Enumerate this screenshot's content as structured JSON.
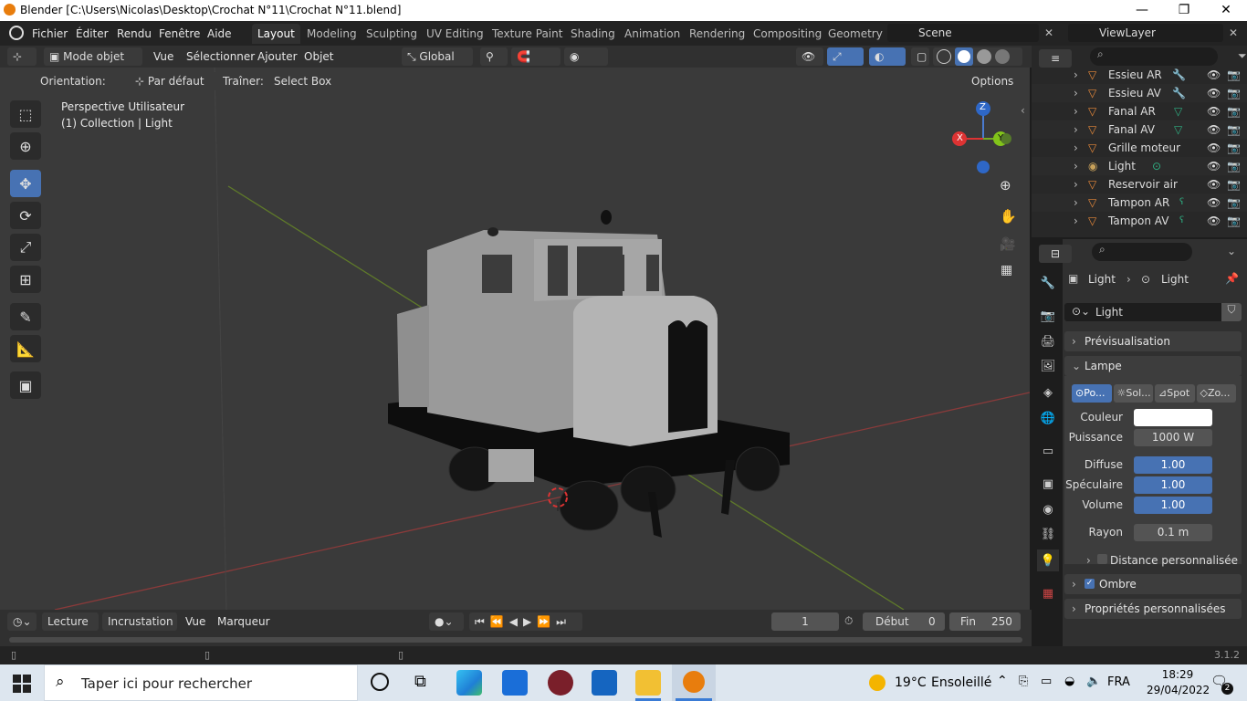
{
  "window": {
    "title": "Blender [C:\\Users\\Nicolas\\Desktop\\Crochat N°11\\Crochat N°11.blend]"
  },
  "menu": [
    "Fichier",
    "Éditer",
    "Rendu",
    "Fenêtre",
    "Aide"
  ],
  "workspaces": [
    "Layout",
    "Modeling",
    "Sculpting",
    "UV Editing",
    "Texture Paint",
    "Shading",
    "Animation",
    "Rendering",
    "Compositing",
    "Geometry"
  ],
  "scene": "Scene",
  "view_layer": "ViewLayer",
  "header": {
    "mode": "Mode objet",
    "menus": [
      "Vue",
      "Sélectionner",
      "Ajouter",
      "Objet"
    ],
    "transform": "Global",
    "orientation_label": "Orientation:",
    "orientation_value": "Par défaut",
    "drag_label": "Traîner:",
    "drag_value": "Select Box",
    "options": "Options"
  },
  "viewport": {
    "line1": "Perspective Utilisateur",
    "line2": "(1) Collection | Light"
  },
  "gizmo": {
    "x": "X",
    "y": "Y",
    "z": "Z"
  },
  "outliner": [
    "Essieu AR",
    "Essieu AV",
    "Fanal AR",
    "Fanal AV",
    "Grille moteur",
    "Light",
    "Reservoir air",
    "Tampon AR",
    "Tampon AV"
  ],
  "properties": {
    "breadcrumb_a": "Light",
    "breadcrumb_b": "Light",
    "datablock": "Light",
    "panels": {
      "preview": "Prévisualisation",
      "lamp": "Lampe",
      "shadow": "Ombre",
      "custom": "Propriétés personnalisées"
    },
    "light_types": [
      "Po...",
      "Sol...",
      "Spot",
      "Zo..."
    ],
    "color_label": "Couleur",
    "power_label": "Puissance",
    "power": "1000 W",
    "diffuse_label": "Diffuse",
    "diffuse": "1.00",
    "specular_label": "Spéculaire",
    "specular": "1.00",
    "volume_label": "Volume",
    "volume": "1.00",
    "radius_label": "Rayon",
    "radius": "0.1 m",
    "custom_distance": "Distance personnalisée"
  },
  "timeline": {
    "menus": [
      "Lecture",
      "Incrustation",
      "Vue",
      "Marqueur"
    ],
    "frame": "1",
    "start_label": "Début",
    "start": "0",
    "end_label": "Fin",
    "end": "250"
  },
  "status": {
    "version": "3.1.2"
  },
  "taskbar": {
    "search": "Taper ici pour rechercher",
    "weather_temp": "19°C",
    "weather_desc": "Ensoleillé",
    "lang": "FRA",
    "time": "18:29",
    "date": "29/04/2022",
    "notif": "2"
  }
}
